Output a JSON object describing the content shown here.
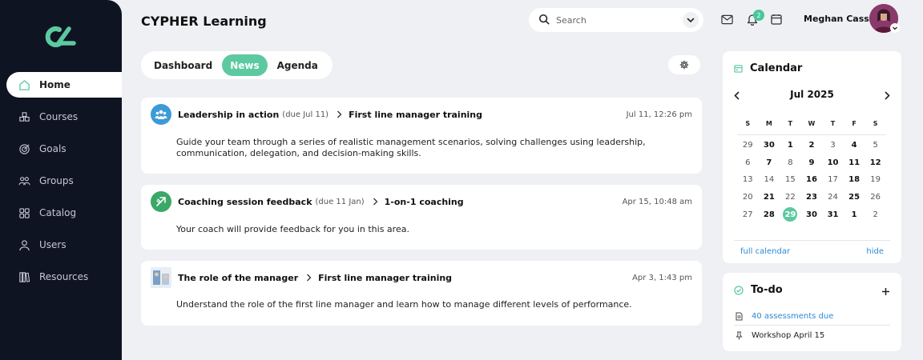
{
  "app": {
    "title": "CYPHER Learning"
  },
  "sidebar": {
    "items": [
      {
        "label": "Home",
        "icon": "home-icon"
      },
      {
        "label": "Courses",
        "icon": "courses-icon"
      },
      {
        "label": "Goals",
        "icon": "goals-icon"
      },
      {
        "label": "Groups",
        "icon": "groups-icon"
      },
      {
        "label": "Catalog",
        "icon": "catalog-icon"
      },
      {
        "label": "Users",
        "icon": "users-icon"
      },
      {
        "label": "Resources",
        "icon": "resources-icon"
      }
    ],
    "active": "Home"
  },
  "header": {
    "search_placeholder": "Search",
    "notification_count": "2",
    "user_name": "Meghan Cass"
  },
  "tabs": [
    {
      "label": "Dashboard"
    },
    {
      "label": "News"
    },
    {
      "label": "Agenda"
    }
  ],
  "active_tab": "News",
  "news": [
    {
      "title": "Leadership in action",
      "due": "(due Jul 11)",
      "course": "First line manager training",
      "date": "Jul 11, 12:26 pm",
      "body": "Guide your team through a series of realistic management scenarios, solving challenges using leadership, communication, delegation, and decision-making skills."
    },
    {
      "title": "Coaching session feedback",
      "due": "(due 11 Jan)",
      "course": "1-on-1 coaching",
      "date": "Apr 15, 10:48 am",
      "body": "Your coach will provide feedback for you in this area."
    },
    {
      "title": "The role of the manager",
      "due": "",
      "course": "First line manager training",
      "date": "Apr 3, 1:43 pm",
      "body": "Understand the role of the first line manager and learn how to manage different levels of performance."
    }
  ],
  "calendar": {
    "title": "Calendar",
    "month": "Jul 2025",
    "weekdays": [
      "S",
      "M",
      "T",
      "W",
      "T",
      "F",
      "S"
    ],
    "weeks": [
      [
        {
          "d": "29",
          "b": false
        },
        {
          "d": "30",
          "b": true
        },
        {
          "d": "1",
          "b": true
        },
        {
          "d": "2",
          "b": true
        },
        {
          "d": "3",
          "b": false
        },
        {
          "d": "4",
          "b": true
        },
        {
          "d": "5",
          "b": false
        }
      ],
      [
        {
          "d": "6",
          "b": false
        },
        {
          "d": "7",
          "b": true
        },
        {
          "d": "8",
          "b": false
        },
        {
          "d": "9",
          "b": true
        },
        {
          "d": "10",
          "b": true
        },
        {
          "d": "11",
          "b": true
        },
        {
          "d": "12",
          "b": true
        }
      ],
      [
        {
          "d": "13",
          "b": false
        },
        {
          "d": "14",
          "b": false
        },
        {
          "d": "15",
          "b": false
        },
        {
          "d": "16",
          "b": true
        },
        {
          "d": "17",
          "b": false
        },
        {
          "d": "18",
          "b": true
        },
        {
          "d": "19",
          "b": false
        }
      ],
      [
        {
          "d": "20",
          "b": false
        },
        {
          "d": "21",
          "b": true
        },
        {
          "d": "22",
          "b": false
        },
        {
          "d": "23",
          "b": true
        },
        {
          "d": "24",
          "b": false
        },
        {
          "d": "25",
          "b": true
        },
        {
          "d": "26",
          "b": false
        }
      ],
      [
        {
          "d": "27",
          "b": false
        },
        {
          "d": "28",
          "b": true
        },
        {
          "d": "29",
          "b": true,
          "today": true
        },
        {
          "d": "30",
          "b": true
        },
        {
          "d": "31",
          "b": true
        },
        {
          "d": "1",
          "b": true
        },
        {
          "d": "2",
          "b": false
        }
      ]
    ],
    "full_calendar_label": "full calendar",
    "hide_label": "hide"
  },
  "todo": {
    "title": "To-do",
    "items": [
      {
        "label": "40 assessments due",
        "icon": "document-icon",
        "link": true
      },
      {
        "label": "Workshop April 15",
        "icon": "pin-icon",
        "link": false
      }
    ]
  },
  "colors": {
    "accent": "#5cc9a0",
    "sidebar_bg": "#0f1422",
    "link": "#2b8ad6"
  }
}
